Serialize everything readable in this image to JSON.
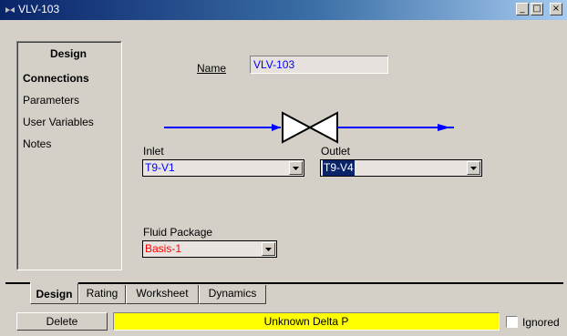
{
  "window": {
    "title": "VLV-103",
    "buttons": {
      "minimize": "_",
      "maximize": "□",
      "close": "×"
    }
  },
  "nav": {
    "heading": "Design",
    "items": [
      {
        "label": "Connections",
        "selected": true
      },
      {
        "label": "Parameters",
        "selected": false
      },
      {
        "label": "User Variables",
        "selected": false
      },
      {
        "label": "Notes",
        "selected": false
      }
    ]
  },
  "form": {
    "name_label": "Name",
    "name_value": "VLV-103",
    "inlet_label": "Inlet",
    "inlet_value": "T9-V1",
    "outlet_label": "Outlet",
    "outlet_value": "T9-V4",
    "fluid_package_label": "Fluid Package",
    "fluid_package_value": "Basis-1"
  },
  "tabs": [
    {
      "label": "Design",
      "active": true
    },
    {
      "label": "Rating",
      "active": false
    },
    {
      "label": "Worksheet",
      "active": false
    },
    {
      "label": "Dynamics",
      "active": false
    }
  ],
  "footer": {
    "delete_label": "Delete",
    "status_text": "Unknown Delta P",
    "ignored_label": "Ignored",
    "ignored_checked": false
  },
  "colors": {
    "title_bar": "#0a246a",
    "stream_line": "#0000ff",
    "value_text": "#0000ff",
    "fluid_package_text": "#ff0000",
    "status_background": "#ffff00",
    "selection_highlight": "#0a246a"
  },
  "icons": {
    "title": "valve-icon",
    "valve": "valve-symbol-icon",
    "dropdown": "dropdown-arrow-icon"
  }
}
